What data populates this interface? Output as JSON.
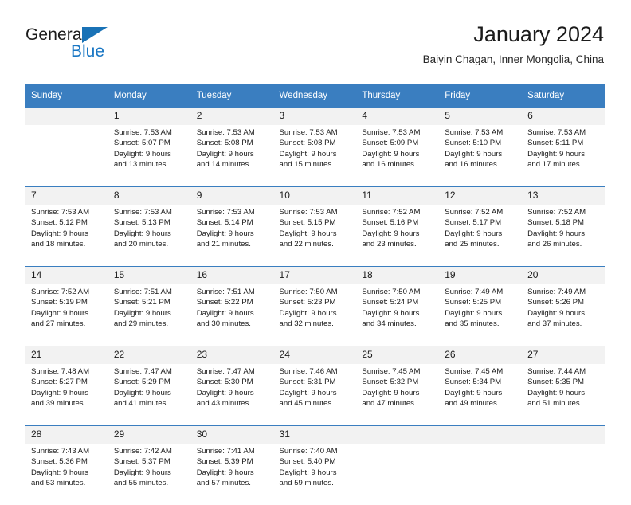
{
  "brand": {
    "name_top": "General",
    "name_bottom": "Blue",
    "triangle_color": "#1972b6",
    "blue_color": "#1a77c4"
  },
  "header": {
    "title": "January 2024",
    "subtitle": "Baiyin Chagan, Inner Mongolia, China"
  },
  "theme": {
    "header_bg": "#3a7ec0",
    "daynum_bg": "#f2f2f2",
    "text": "#1b1b1b"
  },
  "weekdays": [
    "Sunday",
    "Monday",
    "Tuesday",
    "Wednesday",
    "Thursday",
    "Friday",
    "Saturday"
  ],
  "weeks": [
    [
      {
        "day": "",
        "lines": []
      },
      {
        "day": "1",
        "lines": [
          "Sunrise: 7:53 AM",
          "Sunset: 5:07 PM",
          "Daylight: 9 hours",
          "and 13 minutes."
        ]
      },
      {
        "day": "2",
        "lines": [
          "Sunrise: 7:53 AM",
          "Sunset: 5:08 PM",
          "Daylight: 9 hours",
          "and 14 minutes."
        ]
      },
      {
        "day": "3",
        "lines": [
          "Sunrise: 7:53 AM",
          "Sunset: 5:08 PM",
          "Daylight: 9 hours",
          "and 15 minutes."
        ]
      },
      {
        "day": "4",
        "lines": [
          "Sunrise: 7:53 AM",
          "Sunset: 5:09 PM",
          "Daylight: 9 hours",
          "and 16 minutes."
        ]
      },
      {
        "day": "5",
        "lines": [
          "Sunrise: 7:53 AM",
          "Sunset: 5:10 PM",
          "Daylight: 9 hours",
          "and 16 minutes."
        ]
      },
      {
        "day": "6",
        "lines": [
          "Sunrise: 7:53 AM",
          "Sunset: 5:11 PM",
          "Daylight: 9 hours",
          "and 17 minutes."
        ]
      }
    ],
    [
      {
        "day": "7",
        "lines": [
          "Sunrise: 7:53 AM",
          "Sunset: 5:12 PM",
          "Daylight: 9 hours",
          "and 18 minutes."
        ]
      },
      {
        "day": "8",
        "lines": [
          "Sunrise: 7:53 AM",
          "Sunset: 5:13 PM",
          "Daylight: 9 hours",
          "and 20 minutes."
        ]
      },
      {
        "day": "9",
        "lines": [
          "Sunrise: 7:53 AM",
          "Sunset: 5:14 PM",
          "Daylight: 9 hours",
          "and 21 minutes."
        ]
      },
      {
        "day": "10",
        "lines": [
          "Sunrise: 7:53 AM",
          "Sunset: 5:15 PM",
          "Daylight: 9 hours",
          "and 22 minutes."
        ]
      },
      {
        "day": "11",
        "lines": [
          "Sunrise: 7:52 AM",
          "Sunset: 5:16 PM",
          "Daylight: 9 hours",
          "and 23 minutes."
        ]
      },
      {
        "day": "12",
        "lines": [
          "Sunrise: 7:52 AM",
          "Sunset: 5:17 PM",
          "Daylight: 9 hours",
          "and 25 minutes."
        ]
      },
      {
        "day": "13",
        "lines": [
          "Sunrise: 7:52 AM",
          "Sunset: 5:18 PM",
          "Daylight: 9 hours",
          "and 26 minutes."
        ]
      }
    ],
    [
      {
        "day": "14",
        "lines": [
          "Sunrise: 7:52 AM",
          "Sunset: 5:19 PM",
          "Daylight: 9 hours",
          "and 27 minutes."
        ]
      },
      {
        "day": "15",
        "lines": [
          "Sunrise: 7:51 AM",
          "Sunset: 5:21 PM",
          "Daylight: 9 hours",
          "and 29 minutes."
        ]
      },
      {
        "day": "16",
        "lines": [
          "Sunrise: 7:51 AM",
          "Sunset: 5:22 PM",
          "Daylight: 9 hours",
          "and 30 minutes."
        ]
      },
      {
        "day": "17",
        "lines": [
          "Sunrise: 7:50 AM",
          "Sunset: 5:23 PM",
          "Daylight: 9 hours",
          "and 32 minutes."
        ]
      },
      {
        "day": "18",
        "lines": [
          "Sunrise: 7:50 AM",
          "Sunset: 5:24 PM",
          "Daylight: 9 hours",
          "and 34 minutes."
        ]
      },
      {
        "day": "19",
        "lines": [
          "Sunrise: 7:49 AM",
          "Sunset: 5:25 PM",
          "Daylight: 9 hours",
          "and 35 minutes."
        ]
      },
      {
        "day": "20",
        "lines": [
          "Sunrise: 7:49 AM",
          "Sunset: 5:26 PM",
          "Daylight: 9 hours",
          "and 37 minutes."
        ]
      }
    ],
    [
      {
        "day": "21",
        "lines": [
          "Sunrise: 7:48 AM",
          "Sunset: 5:27 PM",
          "Daylight: 9 hours",
          "and 39 minutes."
        ]
      },
      {
        "day": "22",
        "lines": [
          "Sunrise: 7:47 AM",
          "Sunset: 5:29 PM",
          "Daylight: 9 hours",
          "and 41 minutes."
        ]
      },
      {
        "day": "23",
        "lines": [
          "Sunrise: 7:47 AM",
          "Sunset: 5:30 PM",
          "Daylight: 9 hours",
          "and 43 minutes."
        ]
      },
      {
        "day": "24",
        "lines": [
          "Sunrise: 7:46 AM",
          "Sunset: 5:31 PM",
          "Daylight: 9 hours",
          "and 45 minutes."
        ]
      },
      {
        "day": "25",
        "lines": [
          "Sunrise: 7:45 AM",
          "Sunset: 5:32 PM",
          "Daylight: 9 hours",
          "and 47 minutes."
        ]
      },
      {
        "day": "26",
        "lines": [
          "Sunrise: 7:45 AM",
          "Sunset: 5:34 PM",
          "Daylight: 9 hours",
          "and 49 minutes."
        ]
      },
      {
        "day": "27",
        "lines": [
          "Sunrise: 7:44 AM",
          "Sunset: 5:35 PM",
          "Daylight: 9 hours",
          "and 51 minutes."
        ]
      }
    ],
    [
      {
        "day": "28",
        "lines": [
          "Sunrise: 7:43 AM",
          "Sunset: 5:36 PM",
          "Daylight: 9 hours",
          "and 53 minutes."
        ]
      },
      {
        "day": "29",
        "lines": [
          "Sunrise: 7:42 AM",
          "Sunset: 5:37 PM",
          "Daylight: 9 hours",
          "and 55 minutes."
        ]
      },
      {
        "day": "30",
        "lines": [
          "Sunrise: 7:41 AM",
          "Sunset: 5:39 PM",
          "Daylight: 9 hours",
          "and 57 minutes."
        ]
      },
      {
        "day": "31",
        "lines": [
          "Sunrise: 7:40 AM",
          "Sunset: 5:40 PM",
          "Daylight: 9 hours",
          "and 59 minutes."
        ]
      },
      {
        "day": "",
        "lines": []
      },
      {
        "day": "",
        "lines": []
      },
      {
        "day": "",
        "lines": []
      }
    ]
  ]
}
